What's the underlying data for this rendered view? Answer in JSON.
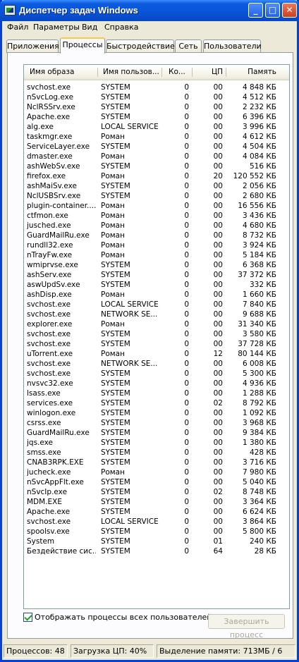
{
  "window": {
    "title": "Диспетчер задач Windows",
    "minimize_glyph": "_",
    "maximize_glyph": "□",
    "close_glyph": "✕"
  },
  "menu": [
    "Файл",
    "Параметры",
    "Вид",
    "Справка"
  ],
  "tabs": [
    {
      "label": "Приложения",
      "active": false
    },
    {
      "label": "Процессы",
      "active": true
    },
    {
      "label": "Быстродействие",
      "active": false
    },
    {
      "label": "Сеть",
      "active": false
    },
    {
      "label": "Пользователи",
      "active": false
    }
  ],
  "columns": [
    "Имя образа",
    "Имя пользов...",
    "Ко...",
    "ЦП",
    "Память"
  ],
  "processes": [
    [
      "svchost.exe",
      "SYSTEM",
      "0",
      "00",
      "4 848 КБ"
    ],
    [
      "nSvcLog.exe",
      "SYSTEM",
      "0",
      "00",
      "4 512 КБ"
    ],
    [
      "NclRSSrv.exe",
      "SYSTEM",
      "0",
      "00",
      "2 232 КБ"
    ],
    [
      "Apache.exe",
      "SYSTEM",
      "0",
      "00",
      "6 396 КБ"
    ],
    [
      "alg.exe",
      "LOCAL SERVICE",
      "0",
      "00",
      "3 996 КБ"
    ],
    [
      "taskmgr.exe",
      "Роман",
      "0",
      "00",
      "4 612 КБ"
    ],
    [
      "ServiceLayer.exe",
      "SYSTEM",
      "0",
      "00",
      "4 504 КБ"
    ],
    [
      "dmaster.exe",
      "Роман",
      "0",
      "00",
      "4 084 КБ"
    ],
    [
      "ashWebSv.exe",
      "SYSTEM",
      "0",
      "00",
      "516 КБ"
    ],
    [
      "firefox.exe",
      "Роман",
      "0",
      "20",
      "120 552 КБ"
    ],
    [
      "ashMaiSv.exe",
      "SYSTEM",
      "0",
      "00",
      "2 056 КБ"
    ],
    [
      "NclUSBSrv.exe",
      "SYSTEM",
      "0",
      "00",
      "2 680 КБ"
    ],
    [
      "plugin-container....",
      "Роман",
      "0",
      "00",
      "16 556 КБ"
    ],
    [
      "ctfmon.exe",
      "Роман",
      "0",
      "00",
      "3 436 КБ"
    ],
    [
      "jusched.exe",
      "Роман",
      "0",
      "00",
      "4 680 КБ"
    ],
    [
      "GuardMailRu.exe",
      "Роман",
      "0",
      "00",
      "8 732 КБ"
    ],
    [
      "rundll32.exe",
      "Роман",
      "0",
      "00",
      "3 924 КБ"
    ],
    [
      "nTrayFw.exe",
      "Роман",
      "0",
      "00",
      "5 184 КБ"
    ],
    [
      "wmiprvse.exe",
      "SYSTEM",
      "0",
      "00",
      "6 368 КБ"
    ],
    [
      "ashServ.exe",
      "SYSTEM",
      "0",
      "00",
      "37 372 КБ"
    ],
    [
      "aswUpdSv.exe",
      "SYSTEM",
      "0",
      "00",
      "332 КБ"
    ],
    [
      "ashDisp.exe",
      "Роман",
      "0",
      "00",
      "1 660 КБ"
    ],
    [
      "svchost.exe",
      "LOCAL SERVICE",
      "0",
      "00",
      "7 840 КБ"
    ],
    [
      "svchost.exe",
      "NETWORK SE...",
      "0",
      "00",
      "9 688 КБ"
    ],
    [
      "explorer.exe",
      "Роман",
      "0",
      "00",
      "31 340 КБ"
    ],
    [
      "svchost.exe",
      "SYSTEM",
      "0",
      "00",
      "3 580 КБ"
    ],
    [
      "svchost.exe",
      "SYSTEM",
      "0",
      "00",
      "37 728 КБ"
    ],
    [
      "uTorrent.exe",
      "Роман",
      "0",
      "12",
      "80 144 КБ"
    ],
    [
      "svchost.exe",
      "NETWORK SE...",
      "0",
      "00",
      "6 008 КБ"
    ],
    [
      "svchost.exe",
      "SYSTEM",
      "0",
      "00",
      "5 300 КБ"
    ],
    [
      "nvsvc32.exe",
      "SYSTEM",
      "0",
      "00",
      "4 936 КБ"
    ],
    [
      "lsass.exe",
      "SYSTEM",
      "0",
      "00",
      "1 288 КБ"
    ],
    [
      "services.exe",
      "SYSTEM",
      "0",
      "02",
      "8 792 КБ"
    ],
    [
      "winlogon.exe",
      "SYSTEM",
      "0",
      "00",
      "1 092 КБ"
    ],
    [
      "csrss.exe",
      "SYSTEM",
      "0",
      "00",
      "3 968 КБ"
    ],
    [
      "GuardMailRu.exe",
      "SYSTEM",
      "0",
      "00",
      "9 384 КБ"
    ],
    [
      "jqs.exe",
      "SYSTEM",
      "0",
      "00",
      "1 380 КБ"
    ],
    [
      "smss.exe",
      "SYSTEM",
      "0",
      "00",
      "428 КБ"
    ],
    [
      "CNAB3RPK.EXE",
      "SYSTEM",
      "0",
      "00",
      "3 716 КБ"
    ],
    [
      "jucheck.exe",
      "Роман",
      "0",
      "00",
      "7 980 КБ"
    ],
    [
      "nSvcAppFlt.exe",
      "SYSTEM",
      "0",
      "00",
      "5 040 КБ"
    ],
    [
      "nSvcIp.exe",
      "SYSTEM",
      "0",
      "02",
      "8 748 КБ"
    ],
    [
      "MDM.EXE",
      "SYSTEM",
      "0",
      "00",
      "3 364 КБ"
    ],
    [
      "Apache.exe",
      "SYSTEM",
      "0",
      "00",
      "6 624 КБ"
    ],
    [
      "svchost.exe",
      "LOCAL SERVICE",
      "0",
      "00",
      "3 864 КБ"
    ],
    [
      "spoolsv.exe",
      "SYSTEM",
      "0",
      "00",
      "5 800 КБ"
    ],
    [
      "System",
      "SYSTEM",
      "0",
      "01",
      "240 КБ"
    ],
    [
      "Бездействие сис...",
      "SYSTEM",
      "0",
      "64",
      "28 КБ"
    ]
  ],
  "show_all_checkbox": {
    "label": "Отображать процессы всех пользователей",
    "checked": true
  },
  "end_process_button": "Завершить процесс",
  "status": {
    "processes": "Процессов: 48",
    "cpu": "Загрузка ЦП: 40%",
    "memory": "Выделение памяти: 713МБ / 6"
  }
}
